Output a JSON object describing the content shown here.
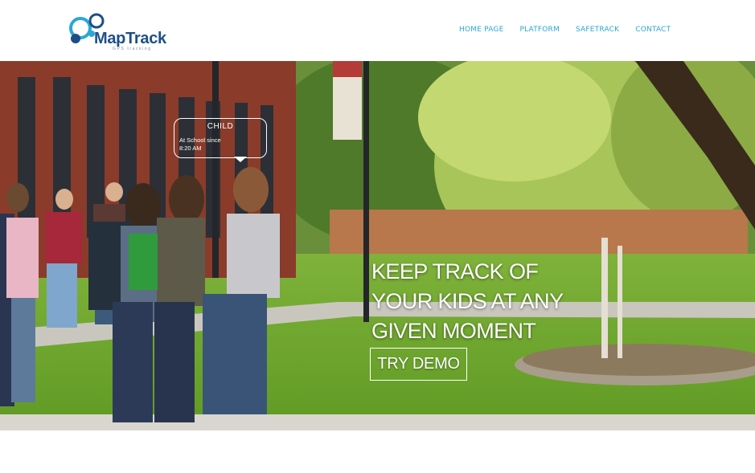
{
  "brand": {
    "name": "MapTrack",
    "tagline": "GPS tracking"
  },
  "nav": {
    "items": [
      {
        "label": "HOME PAGE"
      },
      {
        "label": "PLATFORM"
      },
      {
        "label": "SAFETRACK"
      },
      {
        "label": "CONTACT"
      }
    ]
  },
  "hero": {
    "bubble": {
      "title": "CHILD",
      "status_line1": "At School since",
      "status_line2": "8:20 AM"
    },
    "headline_line1": "KEEP TRACK OF",
    "headline_line2": "YOUR KIDS AT ANY",
    "headline_line3": "GIVEN MOMENT",
    "cta_label": "TRY DEMO"
  },
  "colors": {
    "nav_link": "#2aa7d6",
    "brand_dark": "#1d4e89",
    "brand_accent": "#2aa7d6"
  }
}
